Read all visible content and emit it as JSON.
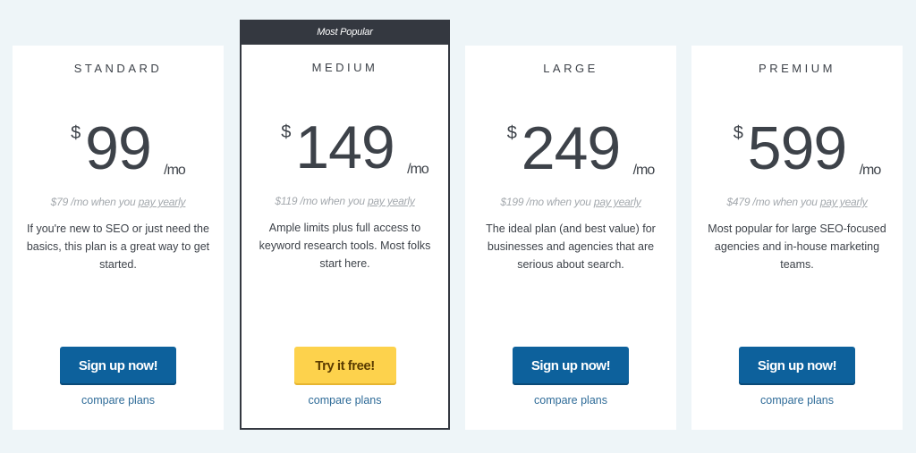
{
  "plans": [
    {
      "name": "STANDARD",
      "currency": "$",
      "price": "99",
      "period": "/mo",
      "yearly_prefix": "$79 /mo when you ",
      "yearly_link": "pay yearly",
      "description": "If you're new to SEO or just need the basics, this plan is a great way to get started.",
      "cta_label": "Sign up now!",
      "compare_label": "compare plans"
    },
    {
      "name": "MEDIUM",
      "badge": "Most Popular",
      "currency": "$",
      "price": "149",
      "period": "/mo",
      "yearly_prefix": "$119 /mo when you ",
      "yearly_link": "pay yearly",
      "description": "Ample limits plus full access to keyword research tools. Most folks start here.",
      "cta_label": "Try it free!",
      "compare_label": "compare plans"
    },
    {
      "name": "LARGE",
      "currency": "$",
      "price": "249",
      "period": "/mo",
      "yearly_prefix": "$199 /mo when you ",
      "yearly_link": "pay yearly",
      "description": "The ideal plan (and best value) for businesses and agencies that are serious about search.",
      "cta_label": "Sign up now!",
      "compare_label": "compare plans"
    },
    {
      "name": "PREMIUM",
      "currency": "$",
      "price": "599",
      "period": "/mo",
      "yearly_prefix": "$479 /mo when you ",
      "yearly_link": "pay yearly",
      "description": "Most popular for large SEO-focused agencies and in-house marketing teams.",
      "cta_label": "Sign up now!",
      "compare_label": "compare plans"
    }
  ],
  "colors": {
    "background": "#eef5f8",
    "primary_button": "#0d619c",
    "featured_button": "#fdd24c",
    "badge": "#343840",
    "link": "#2e6b98"
  }
}
